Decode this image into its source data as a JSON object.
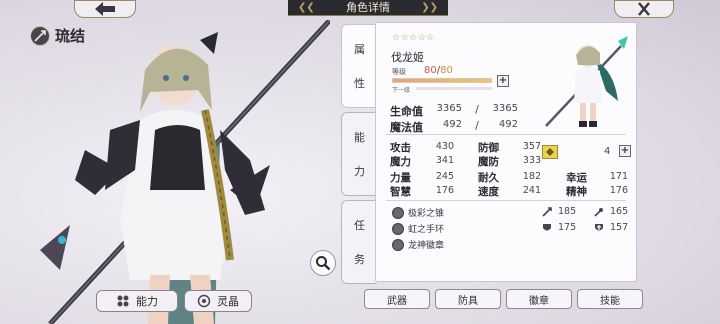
{
  "header": {
    "title": "角色详情"
  },
  "character": {
    "name": "琉结"
  },
  "left_buttons": {
    "ability": "能力",
    "spirit": "灵晶"
  },
  "tabs": {
    "attributes": [
      "属",
      "性"
    ],
    "abilities": [
      "能",
      "力"
    ],
    "tasks": [
      "任",
      "务"
    ]
  },
  "profile": {
    "stars": "☆☆☆☆☆",
    "class": "伐龙姬",
    "level_label": "等级",
    "level_current": "80",
    "level_slash": "/",
    "level_max": "80",
    "level_progress": 1.0,
    "next_label": "下一级"
  },
  "hp": {
    "label": "生命值",
    "cur": "3365",
    "sep": "/",
    "max": "3365"
  },
  "mp": {
    "label": "魔法值",
    "cur": "492",
    "sep": "/",
    "max": "492"
  },
  "stats": [
    {
      "label": "攻击",
      "value": "430"
    },
    {
      "label": "防御",
      "value": "357"
    },
    {
      "label": "魔力",
      "value": "341"
    },
    {
      "label": "魔防",
      "value": "333"
    },
    {
      "label": "力量",
      "value": "245"
    },
    {
      "label": "耐久",
      "value": "182"
    },
    {
      "label": "幸运",
      "value": "171"
    },
    {
      "label": "智慧",
      "value": "176"
    },
    {
      "label": "速度",
      "value": "241"
    },
    {
      "label": "精神",
      "value": "176"
    }
  ],
  "token_value": "4",
  "equipment": [
    {
      "name": "极彩之锥"
    },
    {
      "name": "虹之手环"
    },
    {
      "name": "龙神徽章"
    }
  ],
  "equip_stats": [
    {
      "icon": "sword-icon",
      "value": "185"
    },
    {
      "icon": "wand-icon",
      "value": "165"
    },
    {
      "icon": "shield-icon",
      "value": "175"
    },
    {
      "icon": "cross-shield-icon",
      "value": "157"
    }
  ],
  "bottom_buttons": {
    "weapon": "武器",
    "armor": "防具",
    "badge": "徽章",
    "skill": "技能"
  },
  "colors": {
    "accent": "#b59b55",
    "panel": "#fcfbfd",
    "bar_fill": "#efc46e"
  }
}
